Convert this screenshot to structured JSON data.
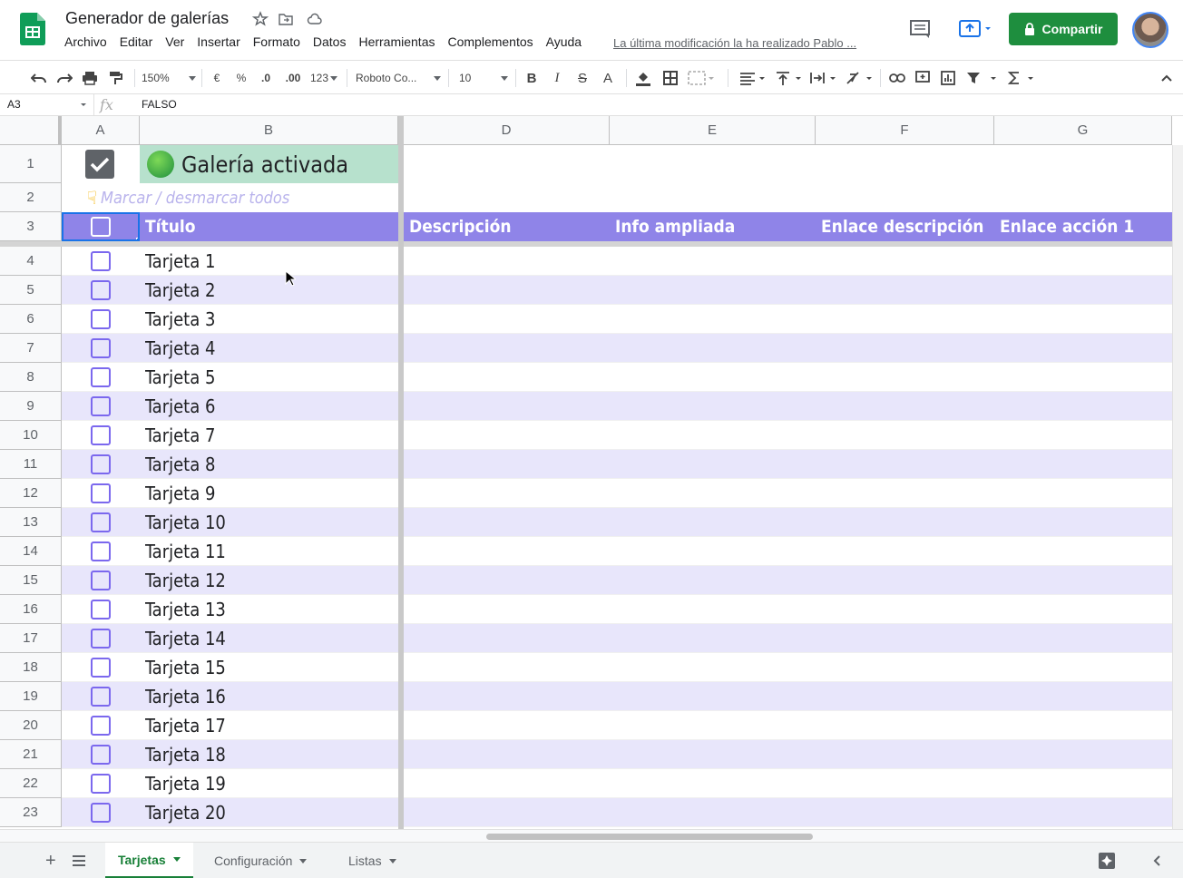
{
  "doc": {
    "title": "Generador de galerías",
    "last_edit": "La última modificación la ha realizado Pablo ..."
  },
  "menu": [
    "Archivo",
    "Editar",
    "Ver",
    "Insertar",
    "Formato",
    "Datos",
    "Herramientas",
    "Complementos",
    "Ayuda"
  ],
  "share_label": "Compartir",
  "toolbar": {
    "zoom": "150%",
    "currency": "€",
    "percent": "%",
    "dec_less": ".0",
    "dec_more": ".00",
    "more_formats": "123",
    "font": "Roboto Co...",
    "font_size": "10",
    "bold": "B",
    "italic": "I",
    "strike": "S",
    "text_color": "A"
  },
  "formula_bar": {
    "cell_ref": "A3",
    "fx": "fx",
    "value": "FALSO"
  },
  "columns": [
    "A",
    "B",
    "D",
    "E",
    "F",
    "G"
  ],
  "row1": {
    "title": "Galería activada",
    "checked": true
  },
  "row2": {
    "hint": "Marcar / desmarcar todos"
  },
  "header_row": {
    "titulo": "Título",
    "descripcion": "Descripción",
    "info": "Info ampliada",
    "enlace_desc": "Enlace descripción",
    "enlace_accion": "Enlace acción 1"
  },
  "rows": [
    {
      "n": "4",
      "t": "Tarjeta 1"
    },
    {
      "n": "5",
      "t": "Tarjeta 2"
    },
    {
      "n": "6",
      "t": "Tarjeta 3"
    },
    {
      "n": "7",
      "t": "Tarjeta 4"
    },
    {
      "n": "8",
      "t": "Tarjeta 5"
    },
    {
      "n": "9",
      "t": "Tarjeta 6"
    },
    {
      "n": "10",
      "t": "Tarjeta 7"
    },
    {
      "n": "11",
      "t": "Tarjeta 8"
    },
    {
      "n": "12",
      "t": "Tarjeta 9"
    },
    {
      "n": "13",
      "t": "Tarjeta 10"
    },
    {
      "n": "14",
      "t": "Tarjeta 11"
    },
    {
      "n": "15",
      "t": "Tarjeta 12"
    },
    {
      "n": "16",
      "t": "Tarjeta 13"
    },
    {
      "n": "17",
      "t": "Tarjeta 14"
    },
    {
      "n": "18",
      "t": "Tarjeta 15"
    },
    {
      "n": "19",
      "t": "Tarjeta 16"
    },
    {
      "n": "20",
      "t": "Tarjeta 17"
    },
    {
      "n": "21",
      "t": "Tarjeta 18"
    },
    {
      "n": "22",
      "t": "Tarjeta 19"
    },
    {
      "n": "23",
      "t": "Tarjeta 20"
    }
  ],
  "row_numbers_top": [
    "1",
    "2",
    "3"
  ],
  "sheets": [
    {
      "name": "Tarjetas",
      "active": true
    },
    {
      "name": "Configuración",
      "active": false
    },
    {
      "name": "Listas",
      "active": false
    }
  ],
  "colors": {
    "header_purple": "#8f84e8",
    "stripe": "#e8e6fb",
    "active_green": "#b7e1cd",
    "checkbox": "#7b68ee",
    "share_green": "#1e8e3e"
  }
}
